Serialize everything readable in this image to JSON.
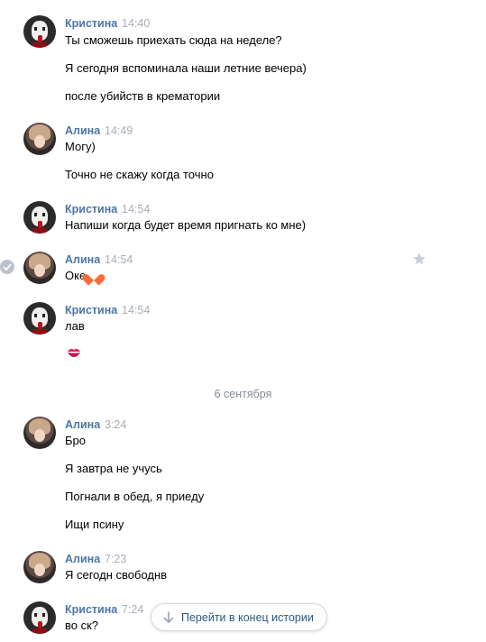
{
  "messages": [
    {
      "author": "Кристина",
      "time": "14:40",
      "lines": [
        "Ты сможешь приехать сюда на неделе?",
        "Я сегодня вспоминала наши летние вечера)",
        "после убийств в крематории"
      ]
    },
    {
      "author": "Алина",
      "time": "14:49",
      "lines": [
        "Могу)",
        "Точно не скажу когда точно"
      ]
    },
    {
      "author": "Кристина",
      "time": "14:54",
      "lines": [
        "Напиши когда будет время пригнать ко мне)"
      ]
    },
    {
      "author": "Алина",
      "time": "14:54",
      "lines": [
        "Оке"
      ]
    },
    {
      "author": "Кристина",
      "time": "14:54",
      "lines": [
        "лав"
      ]
    },
    {
      "author": "Алина",
      "time": "3:24",
      "lines": [
        "Бро",
        "Я завтра не учусь",
        "Погнали в обед, я приеду",
        "Ищи псину"
      ]
    },
    {
      "author": "Алина",
      "time": "7:23",
      "lines": [
        "Я сегодн свободнв"
      ]
    },
    {
      "author": "Кристина",
      "time": "7:24",
      "lines": [
        "во ск?"
      ]
    }
  ],
  "date_separator": "6 сентября",
  "jump_button": {
    "label": "Перейти в конец истории",
    "icon": "arrow-down-icon"
  },
  "icons": {
    "read": "check-icon",
    "favorite": "star-icon",
    "heart_emoji": "orange-heart-icon",
    "kiss_emoji": "kiss-mark-icon"
  },
  "colors": {
    "author": "#4a76a8",
    "time": "#a8aeb7",
    "link": "#2a5885",
    "date": "#818c99"
  }
}
